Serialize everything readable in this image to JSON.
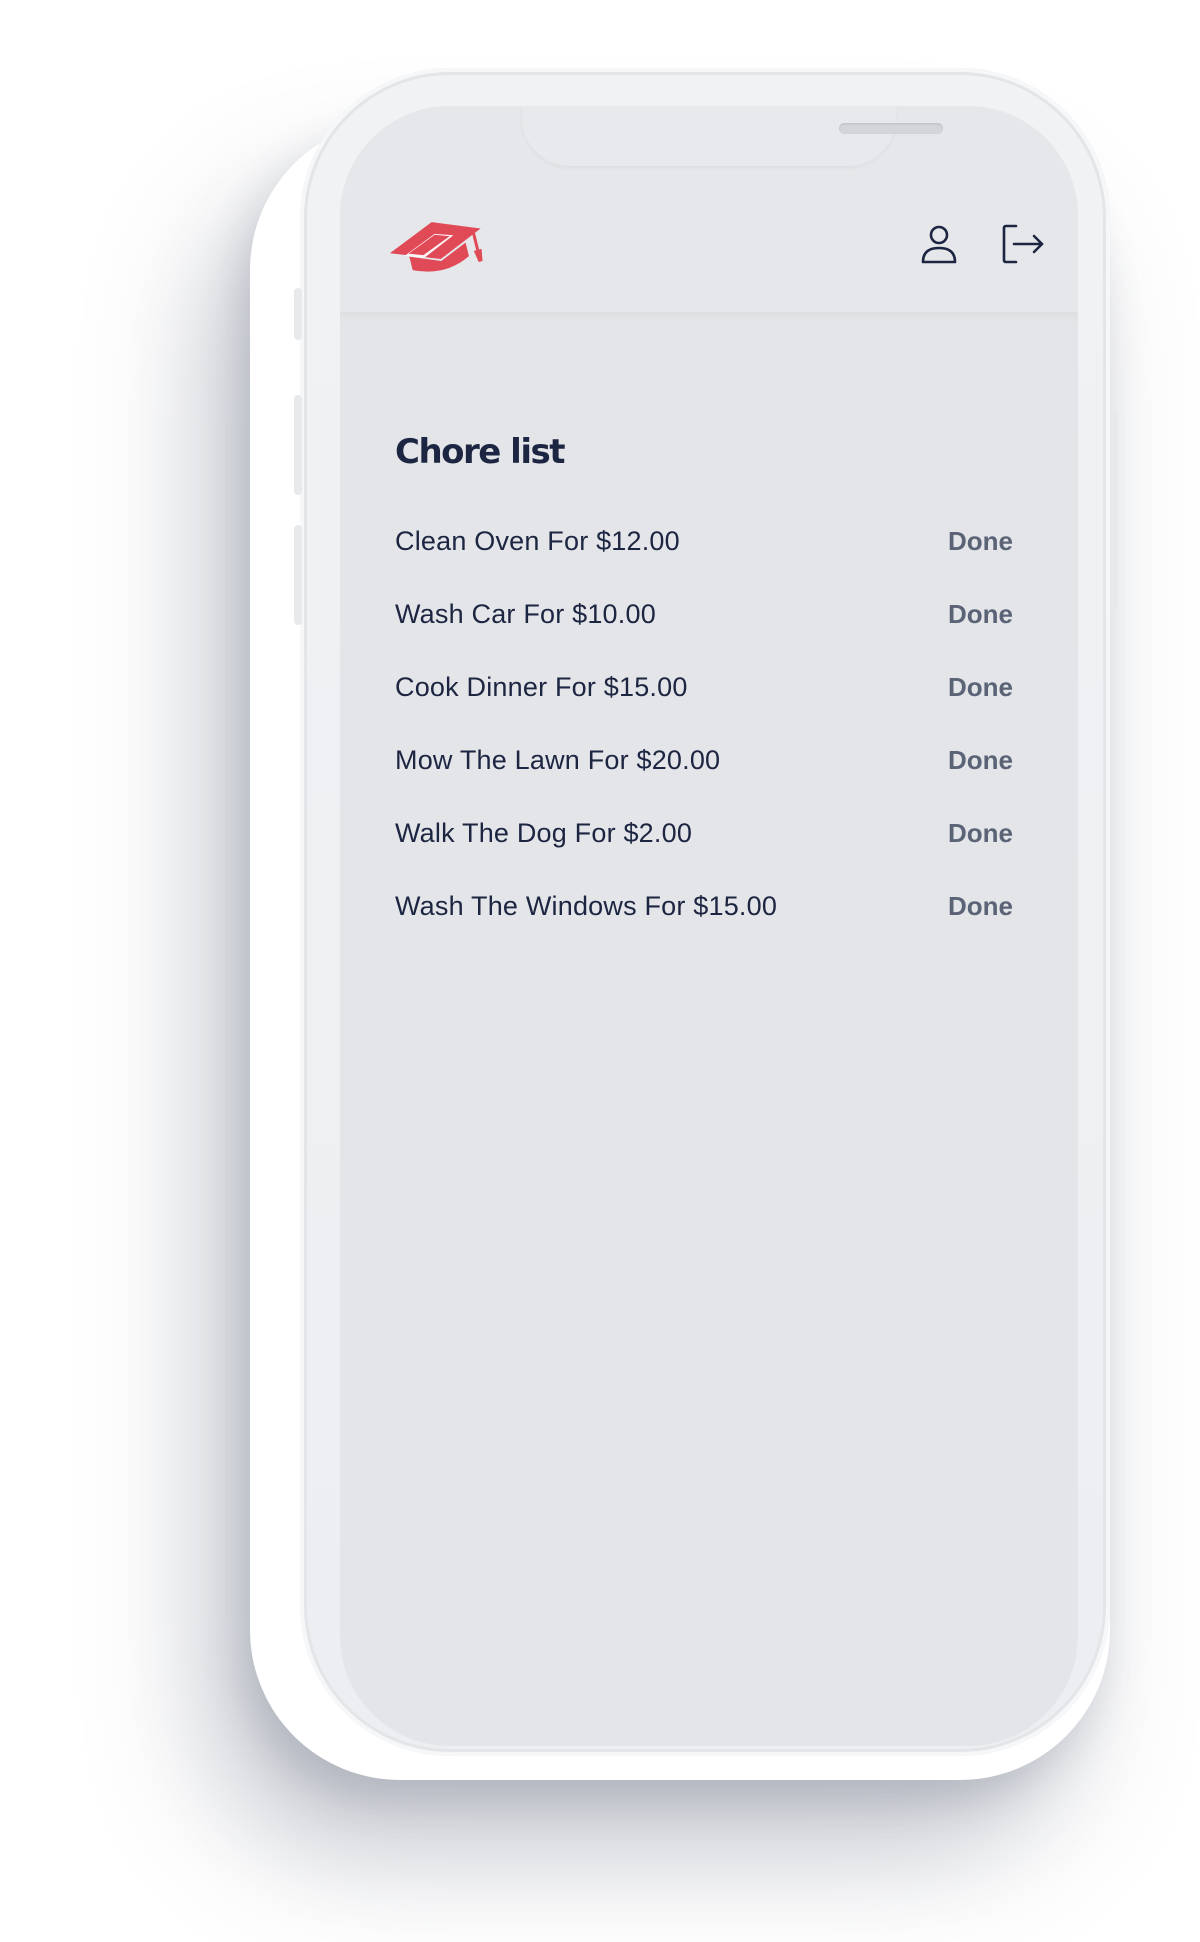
{
  "app": {
    "logo_icon": "graduation-cap-icon",
    "accent_color": "#e04a57",
    "text_color": "#1c2541"
  },
  "header": {
    "profile_icon": "user-icon",
    "logout_icon": "logout-icon"
  },
  "main": {
    "title": "Chore list",
    "chores": [
      {
        "label": "Clean Oven For $12.00",
        "action": "Done"
      },
      {
        "label": "Wash Car For $10.00",
        "action": "Done"
      },
      {
        "label": "Cook Dinner For $15.00",
        "action": "Done"
      },
      {
        "label": "Mow The Lawn For $20.00",
        "action": "Done"
      },
      {
        "label": "Walk The Dog For $2.00",
        "action": "Done"
      },
      {
        "label": "Wash The Windows For $15.00",
        "action": "Done"
      }
    ]
  }
}
